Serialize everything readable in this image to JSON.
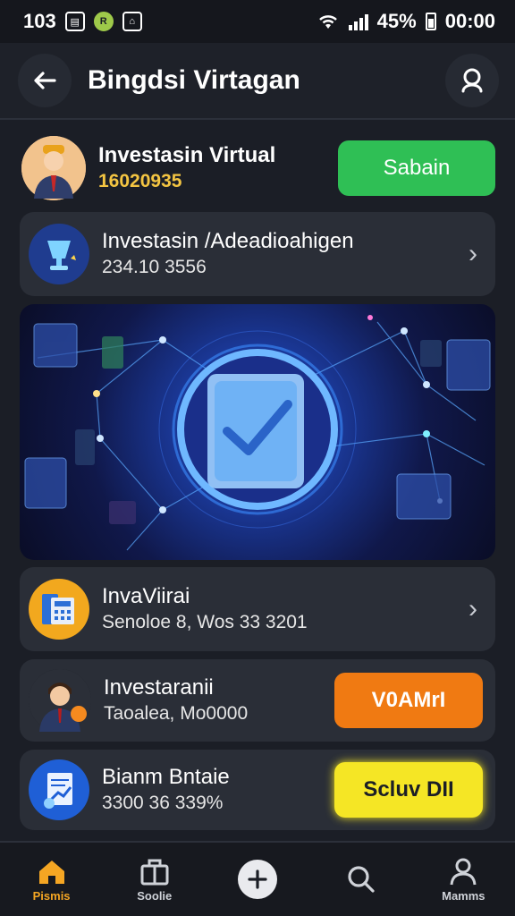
{
  "status_bar": {
    "time": "103",
    "battery_text": "45%",
    "clock": "00:00"
  },
  "header": {
    "title": "Bingdsi Virtagan",
    "back_icon": "arrow-left-icon",
    "search_icon": "search-icon"
  },
  "profile": {
    "title": "Investasin Virtual",
    "value": "16020935",
    "button_label": "Sabain",
    "button_color": "#2fbf55"
  },
  "cards": [
    {
      "title": "Investasin /Adeadioahigen",
      "subtitle": "234.10 3556"
    },
    {
      "title": "InvaViirai",
      "subtitle": "Senoloe 8, Wos 33 3201"
    },
    {
      "title": "Investaranii",
      "subtitle": "Taoalea, Mo0000",
      "button_label": "V0AMrI",
      "button_color": "#f07a12"
    },
    {
      "title": "Bianm Bntaie",
      "subtitle": "3300 36 339%",
      "button_label": "Scluv DII",
      "button_color": "#f5e625"
    }
  ],
  "nav": [
    {
      "label": "Pismis",
      "icon": "home-icon",
      "active": true
    },
    {
      "label": "Soolie",
      "icon": "briefcase-icon",
      "active": false
    },
    {
      "label": "",
      "icon": "plus-icon",
      "active": false
    },
    {
      "label": "",
      "icon": "search-icon",
      "active": false
    },
    {
      "label": "Mamms",
      "icon": "user-icon",
      "active": false
    }
  ],
  "colors": {
    "background": "#1b1e26",
    "card": "#2a2e37",
    "accent_gold": "#f4c542",
    "active_nav": "#f5a623"
  }
}
